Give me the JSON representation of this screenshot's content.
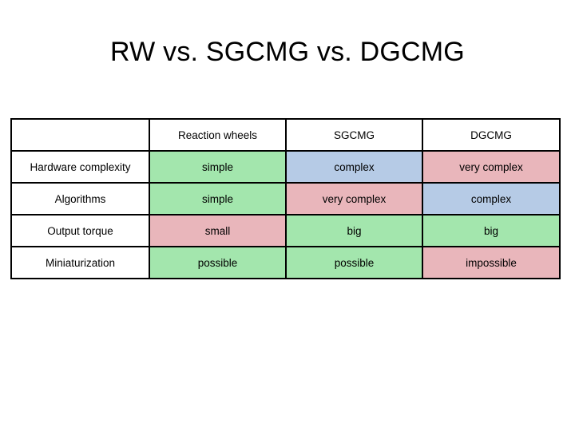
{
  "slide": {
    "title": "RW vs. SGCMG vs. DGCMG",
    "background_color": "#ffffff"
  },
  "palette": {
    "green": "#a3e6ad",
    "blue": "#b6cbe6",
    "pink": "#e9b6bb",
    "plain": "#ffffff",
    "border": "#000000",
    "text": "#000000"
  },
  "table": {
    "name": "comparison-table",
    "columns": [
      {
        "key": "criterion",
        "label": ""
      },
      {
        "key": "rw",
        "label": "Reaction wheels"
      },
      {
        "key": "sgcmg",
        "label": "SGCMG"
      },
      {
        "key": "dgcmg",
        "label": "DGCMG"
      }
    ],
    "rows": [
      {
        "label": "Hardware complexity",
        "cells": [
          {
            "text": "simple",
            "color": "green"
          },
          {
            "text": "complex",
            "color": "blue"
          },
          {
            "text": "very complex",
            "color": "pink"
          }
        ]
      },
      {
        "label": "Algorithms",
        "cells": [
          {
            "text": "simple",
            "color": "green"
          },
          {
            "text": "very complex",
            "color": "pink"
          },
          {
            "text": "complex",
            "color": "blue"
          }
        ]
      },
      {
        "label": "Output torque",
        "cells": [
          {
            "text": "small",
            "color": "pink"
          },
          {
            "text": "big",
            "color": "green"
          },
          {
            "text": "big",
            "color": "green"
          }
        ]
      },
      {
        "label": "Miniaturization",
        "cells": [
          {
            "text": "possible",
            "color": "green"
          },
          {
            "text": "possible",
            "color": "green"
          },
          {
            "text": "impossible",
            "color": "pink"
          }
        ]
      }
    ]
  }
}
